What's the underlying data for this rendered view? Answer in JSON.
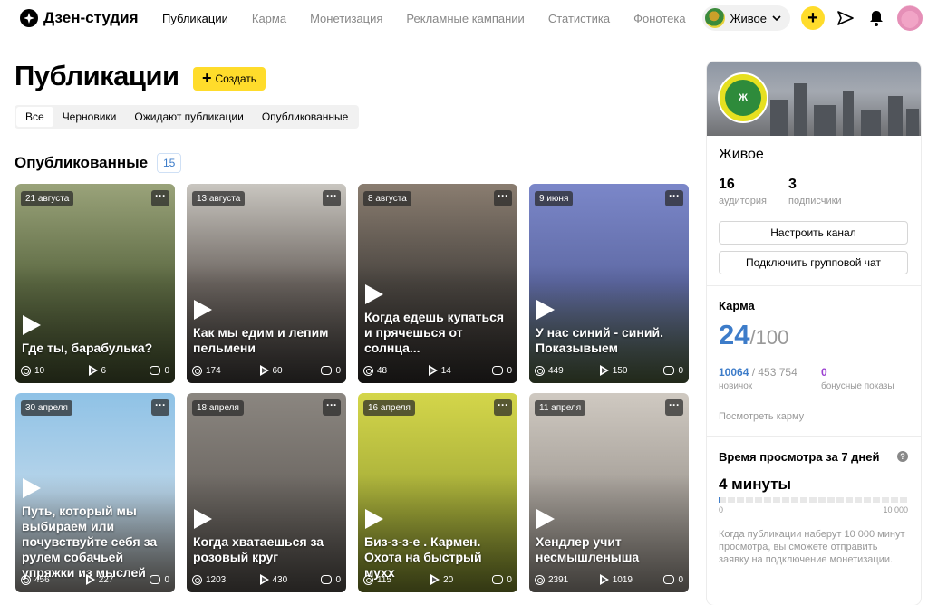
{
  "header": {
    "logo_text": "Дзен-студия",
    "nav": [
      "Публикации",
      "Карма",
      "Монетизация",
      "Рекламные кампании",
      "Статистика",
      "Фонотека"
    ],
    "channel_name": "Живое"
  },
  "page": {
    "title": "Публикации",
    "create_label": "Создать",
    "filters": [
      "Все",
      "Черновики",
      "Ожидают публикации",
      "Опубликованные"
    ],
    "section_title": "Опубликованные",
    "section_count": "15"
  },
  "cards": [
    {
      "date": "21 августа",
      "title": "Где ты, барабулька?",
      "views": "10",
      "plays": "6",
      "comments": "0",
      "colors": [
        "#9aa37a",
        "#5d6a43",
        "#3f4a2b"
      ]
    },
    {
      "date": "13 августа",
      "title": "Как мы едим и лепим пельмени",
      "views": "174",
      "plays": "60",
      "comments": "0",
      "colors": [
        "#c9c6c0",
        "#6e6762",
        "#3a3735"
      ]
    },
    {
      "date": "8 августа",
      "title": "Когда едешь купаться и прячешься от солнца...",
      "views": "48",
      "plays": "14",
      "comments": "0",
      "colors": [
        "#8a7d70",
        "#4b4641",
        "#2b2826"
      ]
    },
    {
      "date": "9 июня",
      "title": "У нас синий - синий. Показывыем",
      "views": "449",
      "plays": "150",
      "comments": "0",
      "colors": [
        "#7b87c9",
        "#5f6aa5",
        "#4a5a3a"
      ]
    },
    {
      "date": "30 апреля",
      "title": "Путь, который мы выбираем или почувствуйте себя за рулем собачьей упряжки из мыслей",
      "views": "456",
      "plays": "227",
      "comments": "0",
      "colors": [
        "#8fc2e6",
        "#b8d5ea",
        "#8e8a84"
      ]
    },
    {
      "date": "18 апреля",
      "title": "Когда хватаешься за розовый круг",
      "views": "1203",
      "plays": "430",
      "comments": "0",
      "colors": [
        "#8b8680",
        "#6d6863",
        "#4e4a46"
      ]
    },
    {
      "date": "16 апреля",
      "title": "Биз-з-з-е . Кармен. Охота на быстрый мухх",
      "views": "115",
      "plays": "20",
      "comments": "0",
      "colors": [
        "#d4d64a",
        "#a9b03a",
        "#6f7a2a"
      ]
    },
    {
      "date": "11 апреля",
      "title": "Хендлер учит несмышленыша",
      "views": "2391",
      "plays": "1019",
      "comments": "0",
      "colors": [
        "#cfc9c1",
        "#a6a099",
        "#8a847d"
      ]
    }
  ],
  "sidebar": {
    "channel_name": "Живое",
    "avatar_text": "Ж\nЖИВОЕ",
    "audience_value": "16",
    "audience_label": "аудитория",
    "subscribers_value": "3",
    "subscribers_label": "подписчики",
    "setup_button": "Настроить канал",
    "group_chat_button": "Подключить групповой чат",
    "karma_title": "Карма",
    "karma_value": "24",
    "karma_max": "/100",
    "novice_value": "10064",
    "novice_total": " / 453 754",
    "novice_label": "новичок",
    "bonus_value": "0",
    "bonus_label": "бонусные показы",
    "karma_link": "Посмотреть карму",
    "watch_title": "Время просмотра за 7 дней",
    "watch_value": "4 минуты",
    "watch_progress": 0.0004,
    "scale_min": "0",
    "scale_max": "10 000",
    "note": "Когда публикации наберут 10 000 минут просмотра, вы сможете отправить заявку на подключение монетизации."
  },
  "colors": {
    "accent_yellow": "#ffdc2b",
    "link_blue": "#3d7cc9",
    "bonus_purple": "#9b3fd1"
  }
}
